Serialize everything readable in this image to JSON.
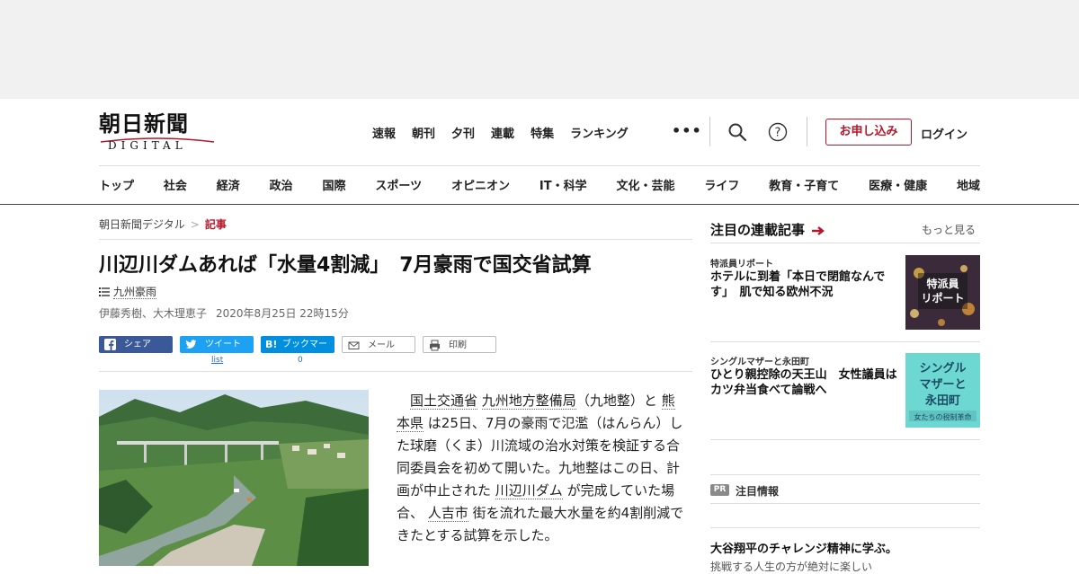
{
  "logo": {
    "jp": "朝日新聞",
    "en": "DIGITAL"
  },
  "topnav": [
    "速報",
    "朝刊",
    "夕刊",
    "連載",
    "特集",
    "ランキング"
  ],
  "more_dots": "•••",
  "signup": "お申し込み",
  "login": "ログイン",
  "categories": [
    "トップ",
    "社会",
    "経済",
    "政治",
    "国際",
    "スポーツ",
    "オピニオン",
    "IT・科学",
    "文化・芸能",
    "ライフ",
    "教育・子育て",
    "医療・健康",
    "地域"
  ],
  "breadcrumb": {
    "home": "朝日新聞デジタル",
    "sep": ">",
    "current": "記事"
  },
  "article": {
    "headline": "川辺川ダムあれば「水量4割減」　7月豪雨で国交省試算",
    "tag": "九州豪雨",
    "authors": "伊藤秀樹、大木理恵子",
    "date": "2020年8月25日 22時15分",
    "body": {
      "l1": "国土交通省",
      "t1": " ",
      "l2": "九州地方整備局",
      "t2": "（九地整）と ",
      "l3": "熊本県",
      "t3": " は25日、7月の豪雨で氾濫（はんらん）した球磨（くま）川流域の治水対策を検証する合同委員会を初めて開いた。九地整はこの日、計画が中止された ",
      "l4": "川辺川ダム",
      "t4": " が完成していた場合、 ",
      "l5": "人吉市",
      "t5": " 街を流れた最大水量を約4割削減できたとする試算を示した。"
    }
  },
  "share": {
    "facebook": "シェア",
    "twitter": "ツイート",
    "twitter_count": "list",
    "hatena": "ブックマーク",
    "hatena_icon": "B!",
    "hatena_count": "0",
    "mail": "メール",
    "print": "印刷"
  },
  "sidebar": {
    "title": "注目の連載記事",
    "more": "もっと見る",
    "items": [
      {
        "kicker": "特派員リポート",
        "title": "ホテルに到着「本日で閉館なんです」　肌で知る欧州不況",
        "thumb_text": "特派員\nリポート"
      },
      {
        "kicker": "シングルマザーと永田町",
        "title": "ひとり親控除の天王山　女性議員はカツ弁当食べて論戦へ",
        "thumb_text": "シングル\nマザーと\n永田町",
        "thumb_sub": "女たちの税制革命"
      }
    ],
    "pr_badge": "PR",
    "pr_title": "注目情報",
    "bottom_title": "大谷翔平のチャレンジ精神に学ぶ。",
    "bottom_sub": "挑戦する人生の方が絶対に楽しい"
  },
  "colors": {
    "accent": "#b5172a",
    "facebook": "#3b5998",
    "twitter": "#1da1f2",
    "hatena": "#008fde"
  }
}
